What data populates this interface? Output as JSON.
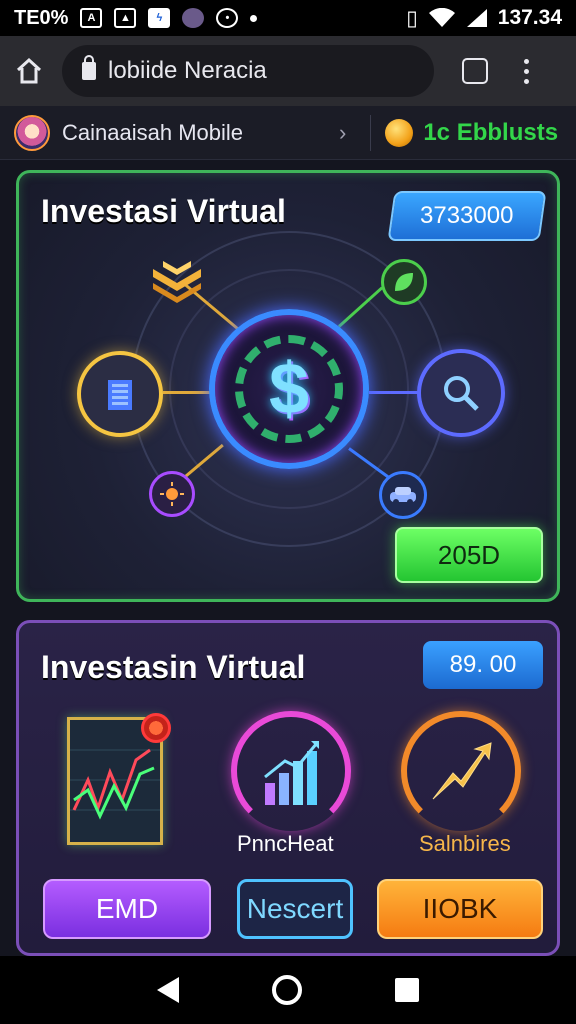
{
  "status_bar": {
    "left_text": "TE0%",
    "time": "137.34",
    "icons": [
      "a-icon",
      "photo-icon",
      "bolt-icon",
      "app-icon",
      "timer-icon",
      "dot-icon"
    ],
    "right_icons": [
      "vibrate-icon",
      "wifi-icon",
      "signal-icon"
    ]
  },
  "browser": {
    "url": "lobiide Neracia"
  },
  "app_header": {
    "app_name": "Cainaaisah Mobile",
    "coin_label": "1c Ebblusts"
  },
  "panel1": {
    "title": "Investasi Virtual",
    "value": "3733000",
    "button": "205D"
  },
  "panel2": {
    "title": "Investasin Virtual",
    "value": "89. 00",
    "gauge1_label": "PnncHeat",
    "gauge2_label": "Salnbires",
    "buttons": [
      "EMD",
      "Nescert",
      "IIOBK"
    ]
  },
  "colors": {
    "panel1_border": "#3fb55a",
    "panel2_border": "#7b4fb8",
    "green_button": "#24c532",
    "purple_button": "#7a2fe0",
    "orange_button": "#f57b12",
    "blue_value": "#1e6fd6"
  }
}
